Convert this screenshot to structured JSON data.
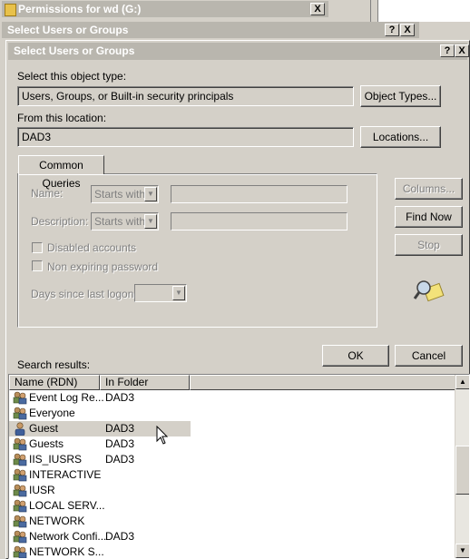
{
  "windows": {
    "permissions_title": "Permissions for wd (G:)",
    "select_users_back_title": "Select Users or Groups"
  },
  "dialog": {
    "title": "Select Users or Groups",
    "help_btn": "?",
    "close_btn": "X",
    "object_type_label": "Select this object type:",
    "object_type_value": "Users, Groups, or Built-in security principals",
    "object_types_button": "Object Types...",
    "location_label": "From this location:",
    "location_value": "DAD3",
    "locations_button": "Locations...",
    "tab_common_queries": "Common Queries",
    "name_label": "Name:",
    "name_mode": "Starts with",
    "description_label": "Description:",
    "description_mode": "Starts with",
    "disabled_accounts_label": "Disabled accounts",
    "non_expiring_label": "Non expiring password",
    "days_since_logon_label": "Days since last logon:",
    "columns_button": "Columns...",
    "find_now_button": "Find Now",
    "stop_button": "Stop",
    "ok_button": "OK",
    "cancel_button": "Cancel",
    "search_results_label": "Search results:"
  },
  "results": {
    "columns": [
      "Name (RDN)",
      "In Folder"
    ],
    "rows": [
      {
        "name": "Event Log Re...",
        "folder": "DAD3",
        "icon": "group-icon"
      },
      {
        "name": "Everyone",
        "folder": "",
        "icon": "group-icon"
      },
      {
        "name": "Guest",
        "folder": "DAD3",
        "icon": "user-icon",
        "selected": true
      },
      {
        "name": "Guests",
        "folder": "DAD3",
        "icon": "group-icon"
      },
      {
        "name": "IIS_IUSRS",
        "folder": "DAD3",
        "icon": "group-icon"
      },
      {
        "name": "INTERACTIVE",
        "folder": "",
        "icon": "group-icon"
      },
      {
        "name": "IUSR",
        "folder": "",
        "icon": "group-icon"
      },
      {
        "name": "LOCAL SERV...",
        "folder": "",
        "icon": "group-icon"
      },
      {
        "name": "NETWORK",
        "folder": "",
        "icon": "group-icon"
      },
      {
        "name": "Network Confi...",
        "folder": "DAD3",
        "icon": "group-icon"
      },
      {
        "name": "NETWORK S...",
        "folder": "",
        "icon": "group-icon"
      }
    ]
  },
  "colors": {
    "face": "#d4d0c8",
    "inactive_title": "#b9b6ae"
  }
}
